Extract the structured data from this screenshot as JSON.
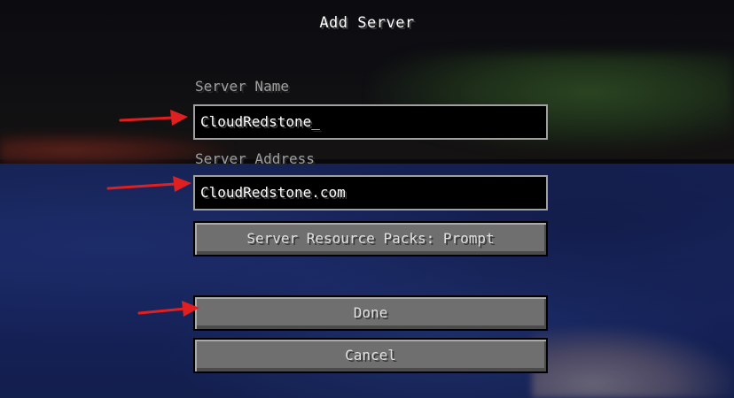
{
  "screen": {
    "title": "Add Server"
  },
  "form": {
    "server_name_label": "Server Name",
    "server_name_value": "CloudRedstone_",
    "server_address_label": "Server Address",
    "server_address_value": "CloudRedstone.com"
  },
  "buttons": {
    "resource_packs": "Server Resource Packs: Prompt",
    "done": "Done",
    "cancel": "Cancel"
  },
  "annotations": {
    "arrow_color": "#e02020",
    "arrow_icon": "red-arrow-icon"
  }
}
